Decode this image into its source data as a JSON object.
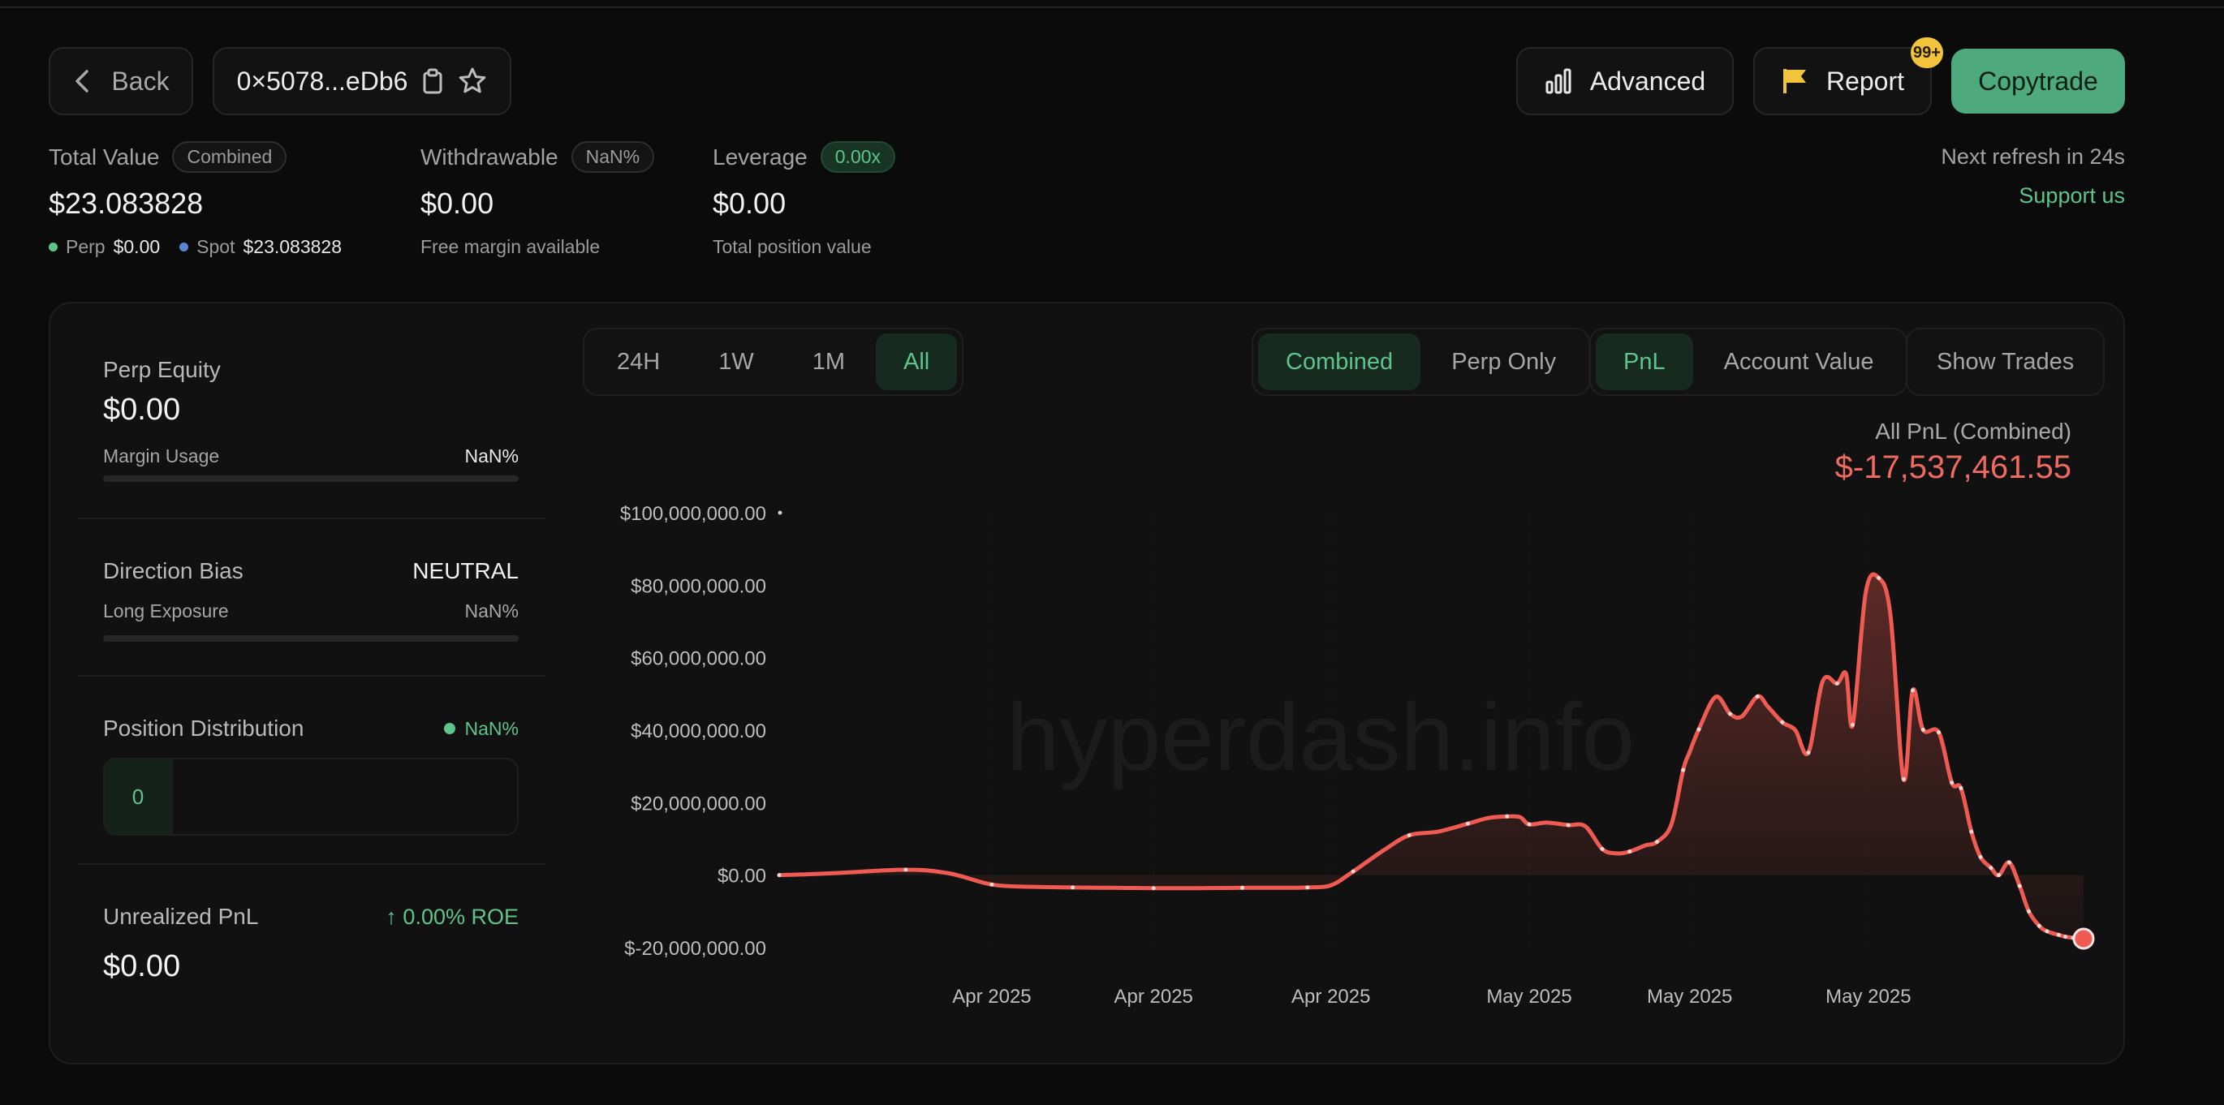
{
  "header": {
    "back_label": "Back",
    "address": "0×5078...eDb6",
    "advanced_label": "Advanced",
    "report_label": "Report",
    "report_badge": "99+",
    "copytrade_label": "Copytrade"
  },
  "stats": {
    "total_value": {
      "label": "Total Value",
      "pill": "Combined",
      "value": "$23.083828",
      "perp_label": "Perp",
      "perp_value": "$0.00",
      "spot_label": "Spot",
      "spot_value": "$23.083828"
    },
    "withdrawable": {
      "label": "Withdrawable",
      "pill": "NaN%",
      "value": "$0.00",
      "sub": "Free margin available"
    },
    "leverage": {
      "label": "Leverage",
      "pill": "0.00x",
      "value": "$0.00",
      "sub": "Total position value"
    },
    "refresh": "Next refresh in 24s",
    "support": "Support us"
  },
  "sidebar": {
    "perp_equity": {
      "title": "Perp Equity",
      "value": "$0.00",
      "margin_label": "Margin Usage",
      "margin_value": "NaN%"
    },
    "direction": {
      "title": "Direction Bias",
      "value": "NEUTRAL",
      "exposure_label": "Long Exposure",
      "exposure_value": "NaN%"
    },
    "distribution": {
      "title": "Position Distribution",
      "value": "NaN%",
      "box_value": "0"
    },
    "unrealized": {
      "title": "Unrealized PnL",
      "roe": "↑ 0.00% ROE",
      "value": "$0.00"
    }
  },
  "controls": {
    "ranges": [
      {
        "label": "24H"
      },
      {
        "label": "1W"
      },
      {
        "label": "1M"
      },
      {
        "label": "All"
      }
    ],
    "active_range": 3,
    "modes": [
      {
        "label": "Combined"
      },
      {
        "label": "Perp Only"
      }
    ],
    "active_mode": 0,
    "metrics": [
      {
        "label": "PnL"
      },
      {
        "label": "Account Value"
      }
    ],
    "active_metric": 0,
    "show_trades": "Show Trades"
  },
  "chart_head": {
    "label": "All PnL (Combined)",
    "value": "$-17,537,461.55"
  },
  "colors": {
    "accent_green": "#5ec48c",
    "loss_red": "#ef5b52",
    "badge_yellow": "#f2c43b"
  },
  "chart_data": {
    "type": "area",
    "title": "",
    "watermark": "hyperdash.info",
    "xlabel": "",
    "ylabel": "",
    "ylim": [
      -20000000,
      100000000
    ],
    "y_ticks": [
      {
        "value": 100000000,
        "label": "$100,000,000.00"
      },
      {
        "value": 80000000,
        "label": "$80,000,000.00"
      },
      {
        "value": 60000000,
        "label": "$60,000,000.00"
      },
      {
        "value": 40000000,
        "label": "$40,000,000.00"
      },
      {
        "value": 20000000,
        "label": "$20,000,000.00"
      },
      {
        "value": 0,
        "label": "$0.00"
      },
      {
        "value": -20000000,
        "label": "$-20,000,000.00"
      }
    ],
    "xlim": [
      0,
      100
    ],
    "x_ticks": [
      {
        "x": 16.3,
        "label": "Apr 2025"
      },
      {
        "x": 28.7,
        "label": "Apr 2025"
      },
      {
        "x": 42.3,
        "label": "Apr 2025"
      },
      {
        "x": 57.5,
        "label": "May 2025"
      },
      {
        "x": 69.8,
        "label": "May 2025"
      },
      {
        "x": 83.5,
        "label": "May 2025"
      }
    ],
    "series": [
      {
        "x": [
          0,
          4,
          9.7,
          13,
          16.3,
          19.2,
          22.5,
          25.6,
          28.7,
          32,
          35.5,
          38.8,
          40.5,
          42.3,
          44,
          46.4,
          48.3,
          50.5,
          52.8,
          54.4,
          55.8,
          56.8,
          57.5,
          58.8,
          60.5,
          61.8,
          63.1,
          64.2,
          65.2,
          66.4,
          67.3,
          68.4,
          69.3,
          69.8,
          70.5,
          71.8,
          72.9,
          73.8,
          75,
          75.8,
          76.9,
          77.9,
          78.9,
          80,
          81.1,
          81.8,
          82.3,
          83.3,
          84.3,
          85.2,
          86.2,
          86.9,
          87.7,
          88.9,
          89.9,
          90.6,
          91.4,
          92.1,
          92.9,
          93.5,
          94.3,
          95.1,
          95.8,
          96.6,
          97.2,
          98.1,
          98.6,
          99.2,
          100
        ],
        "values": [
          0,
          500000,
          1500000,
          500000,
          -2600000,
          -3200000,
          -3400000,
          -3500000,
          -3600000,
          -3600000,
          -3500000,
          -3500000,
          -3400000,
          -2800000,
          1000000,
          7000000,
          11000000,
          12000000,
          14200000,
          15800000,
          16200000,
          16000000,
          14000000,
          14500000,
          13800000,
          13500000,
          7200000,
          6000000,
          6500000,
          8200000,
          9200000,
          14000000,
          29000000,
          34000000,
          40200000,
          49200000,
          44500000,
          43800000,
          49300000,
          46500000,
          42200000,
          40000000,
          33800000,
          53500000,
          52900000,
          55500000,
          41500000,
          78000000,
          82000000,
          71500000,
          26500000,
          51000000,
          40100000,
          39400000,
          25500000,
          24000000,
          12000000,
          5000000,
          2000000,
          0,
          3500000,
          -3000000,
          -10000000,
          -14000000,
          -15500000,
          -16500000,
          -17000000,
          -17300000,
          -17537461.55
        ]
      }
    ],
    "grid": true,
    "legend": "none"
  }
}
